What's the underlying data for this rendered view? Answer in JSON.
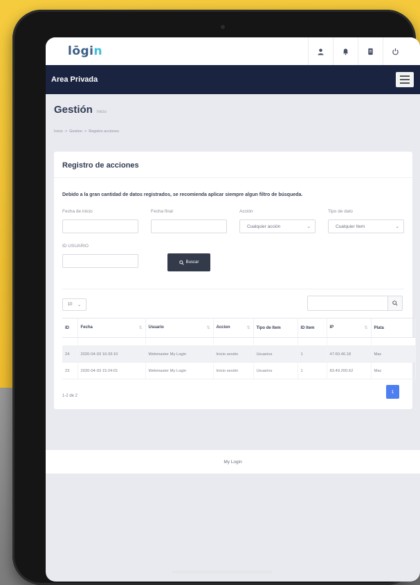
{
  "logo": {
    "text_main": "lōgi",
    "text_accent": "n"
  },
  "header": {
    "icons": [
      "user-icon",
      "bell-icon",
      "document-icon",
      "power-icon"
    ]
  },
  "navbar": {
    "title": "Area Privada"
  },
  "page": {
    "title": "Gestión",
    "subtitle": "Inicio"
  },
  "breadcrumb": {
    "items": [
      "Inicio",
      ">",
      "Gestion",
      ">",
      "Registro acciones"
    ]
  },
  "card": {
    "title": "Registro de acciones",
    "notice": "Debido a la gran cantidad de datos registrados, se recomienda aplicar siempre algun filtro de búsqueda."
  },
  "filters": {
    "start_label": "Fecha de inicio",
    "end_label": "Fecha final",
    "action_label": "Acción",
    "action_value": "Cualquier acción",
    "type_label": "Tipo de dato",
    "type_value": "Cualquier Item",
    "user_label": "ID USUARIO",
    "search_button": "Buscar"
  },
  "table": {
    "page_size": "10",
    "columns": [
      "ID",
      "Fecha",
      "Usuario",
      "Accion",
      "Tipo de Item",
      "ID Item",
      "IP",
      "Plata"
    ],
    "rows": [
      [
        "24",
        "2020-04-03 16:33:10",
        "Webmaster My Login",
        "Inicio sesión",
        "Usuarios",
        "1",
        "47.60.46.18",
        "Mac"
      ],
      [
        "23",
        "2020-04-03 15:24:01",
        "Webmaster My Login",
        "Inicio sesión",
        "Usuarios",
        "1",
        "83.49.200.62",
        "Mac"
      ]
    ],
    "count_text": "1-2 de 2",
    "current_page": "1"
  },
  "footer": {
    "text": "My Login"
  },
  "colors": {
    "navbar": "#1a2340",
    "primary": "#4e7ff0",
    "logo": "#3b5e86",
    "accent": "#3ec0d9"
  }
}
